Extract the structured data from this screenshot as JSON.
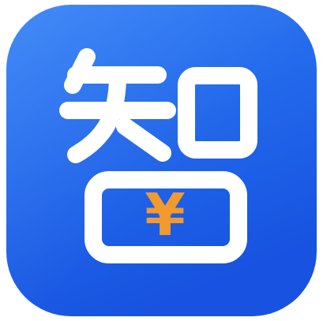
{
  "app_icon": {
    "glyph": "智",
    "currency_symbol": "¥",
    "colors": {
      "background_gradient_start": "#2f7ff7",
      "background_gradient_end": "#1753e0",
      "glyph": "#ffffff",
      "currency": "#f29a2e"
    }
  }
}
